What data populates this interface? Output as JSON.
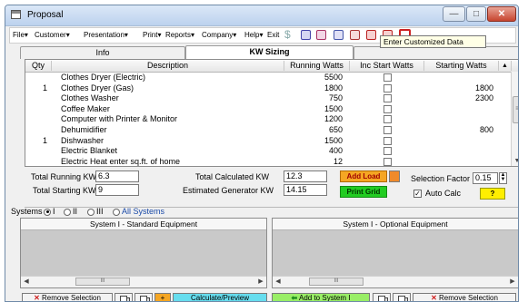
{
  "window": {
    "title": "Proposal"
  },
  "menu": {
    "items": [
      "File",
      "Customer",
      "Presentation",
      "Print",
      "Reports",
      "Company",
      "Help",
      "Exit"
    ],
    "tooltip": "Enter Customized Data"
  },
  "tabs": [
    {
      "label": "Info",
      "active": false
    },
    {
      "label": "KW Sizing",
      "active": true
    },
    {
      "label": "",
      "active": false
    }
  ],
  "grid": {
    "columns": [
      "Qty",
      "Description",
      "Running Watts",
      "Inc Start Watts",
      "Starting Watts"
    ],
    "rows": [
      {
        "qty": "",
        "description": "Clothes Dryer (Electric)",
        "running": "5500",
        "starting": ""
      },
      {
        "qty": "1",
        "description": "Clothes Dryer (Gas)",
        "running": "1800",
        "starting": "1800"
      },
      {
        "qty": "",
        "description": "Clothes Washer",
        "running": "750",
        "starting": "2300"
      },
      {
        "qty": "",
        "description": "Coffee Maker",
        "running": "1500",
        "starting": ""
      },
      {
        "qty": "",
        "description": "Computer with Printer & Monitor",
        "running": "1200",
        "starting": ""
      },
      {
        "qty": "",
        "description": "Dehumidifier",
        "running": "650",
        "starting": "800"
      },
      {
        "qty": "1",
        "description": "Dishwasher",
        "running": "1500",
        "starting": ""
      },
      {
        "qty": "",
        "description": "Electric Blanket",
        "running": "400",
        "starting": ""
      },
      {
        "qty": "",
        "description": "Electric Heat enter sq.ft. of home",
        "running": "12",
        "starting": ""
      }
    ]
  },
  "totals": {
    "running_label": "Total Running KW",
    "running_value": "6.3",
    "starting_label": "Total Starting KW",
    "starting_value": "9",
    "calculated_label": "Total Calculated KW",
    "calculated_value": "12.3",
    "generator_label": "Estimated Generator KW",
    "generator_value": "14.15",
    "add_load": "Add Load",
    "print_grid": "Print Grid",
    "selection_factor_label": "Selection Factor",
    "selection_factor_value": "0.15",
    "auto_calc_label": "Auto Calc",
    "auto_calc_checked": true,
    "help_button": "?"
  },
  "systems": {
    "label": "Systems",
    "options": [
      "I",
      "II",
      "III"
    ],
    "selected": "I",
    "all_systems": "All Systems"
  },
  "panels": {
    "standard_title": "System I - Standard Equipment",
    "optional_title": "System I - Optional Equipment",
    "scroll_thumb": "III"
  },
  "bottom_buttons": {
    "remove_selection_left": "Remove Selection",
    "plus": "+",
    "calculate_preview": "Calculate/Preview",
    "add_to_system": "Add to System I",
    "remove_selection_right": "Remove Selection"
  },
  "colors": {
    "add_load_bg": "#f5a623",
    "print_grid_bg": "#22cc22",
    "help_bg": "#ffee00",
    "calculate_bg": "#66ddee",
    "add_to_system_bg": "#99ee66",
    "orange_swatch": "#f08a2a"
  }
}
